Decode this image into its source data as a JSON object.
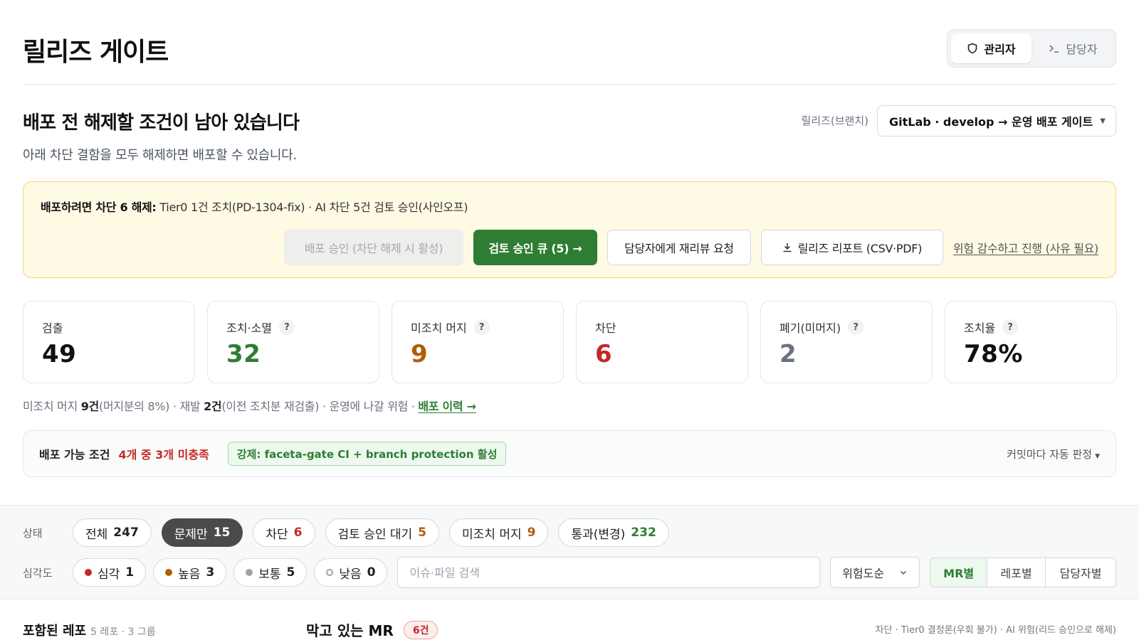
{
  "header": {
    "title": "릴리즈 게이트",
    "roles": [
      {
        "label": "관리자",
        "icon": "shield-icon",
        "active": true
      },
      {
        "label": "담당자",
        "icon": "terminal-icon",
        "active": false
      }
    ]
  },
  "status": {
    "headline": "배포 전 해제할 조건이 남아 있습니다",
    "subline": "아래 차단 결함을 모두 해제하면 배포할 수 있습니다."
  },
  "branch": {
    "label": "릴리즈(브랜치)",
    "value": "GitLab · develop → 운영 배포 게이트"
  },
  "banner": {
    "title": "배포하려면 차단 6 해제:",
    "detail": "Tier0 1건 조치(PD-1304-fix) · AI 차단 5건 검토 승인(사인오프)",
    "buttons": {
      "approve": "배포 승인 (차단 해제 시 활성)",
      "review_queue": "검토 승인 큐 (5) →",
      "rereview": "담당자에게 재리뷰 요청",
      "report": "릴리즈 리포트 (CSV·PDF)",
      "accept_risk": "위험 감수하고 진행 (사유 필요)"
    }
  },
  "stats": [
    {
      "label": "검출",
      "value": "49",
      "help": false,
      "tone": "dark"
    },
    {
      "label": "조치·소멸",
      "value": "32",
      "help": true,
      "tone": "green"
    },
    {
      "label": "미조치 머지",
      "value": "9",
      "help": true,
      "tone": "orange"
    },
    {
      "label": "차단",
      "value": "6",
      "help": false,
      "tone": "red"
    },
    {
      "label": "폐기(미머지)",
      "value": "2",
      "help": true,
      "tone": "gray"
    },
    {
      "label": "조치율",
      "value": "78%",
      "help": true,
      "tone": "dark"
    }
  ],
  "summary": {
    "p1": "미조치 머지 ",
    "b1": "9건",
    "p2": "(머지분의 8%) · 재발 ",
    "b2": "2건",
    "p3": "(이전 조치분 재검출) · 운영에 나갈 위험 · ",
    "link": "배포 이력 →"
  },
  "conditions": {
    "title": "배포 가능 조건",
    "count": "4개 중 3개 미충족",
    "badge": "강제: faceta-gate CI + branch protection 활성",
    "mode": "커밋마다 자동 판정"
  },
  "filters": {
    "status_label": "상태",
    "status_chips": [
      {
        "label": "전체",
        "count": "247",
        "tone": "dark",
        "active": false
      },
      {
        "label": "문제만",
        "count": "15",
        "tone": "dark",
        "active": true
      },
      {
        "label": "차단",
        "count": "6",
        "tone": "red",
        "active": false
      },
      {
        "label": "검토 승인 대기",
        "count": "5",
        "tone": "orange",
        "active": false
      },
      {
        "label": "미조치 머지",
        "count": "9",
        "tone": "orange",
        "active": false
      },
      {
        "label": "통과(변경)",
        "count": "232",
        "tone": "green",
        "active": false
      }
    ],
    "severity_label": "심각도",
    "severity_chips": [
      {
        "label": "심각",
        "count": "1",
        "dot": "red"
      },
      {
        "label": "높음",
        "count": "3",
        "dot": "orange"
      },
      {
        "label": "보통",
        "count": "5",
        "dot": "gray"
      },
      {
        "label": "낮음",
        "count": "0",
        "dot": "hollow"
      }
    ],
    "search_placeholder": "이슈·파일 검색",
    "sort_value": "위험도순",
    "group_options": [
      "MR별",
      "레포별",
      "담당자별"
    ]
  },
  "bottom": {
    "left_title": "포함된 레포",
    "left_meta": "5 레포 · 3 그룹",
    "mid_title": "막고 있는 MR",
    "mid_badge": "6건",
    "right_text": "차단 · Tier0 결정론(우회 불가) · AI 위험(리드 승인으로 해제)"
  }
}
